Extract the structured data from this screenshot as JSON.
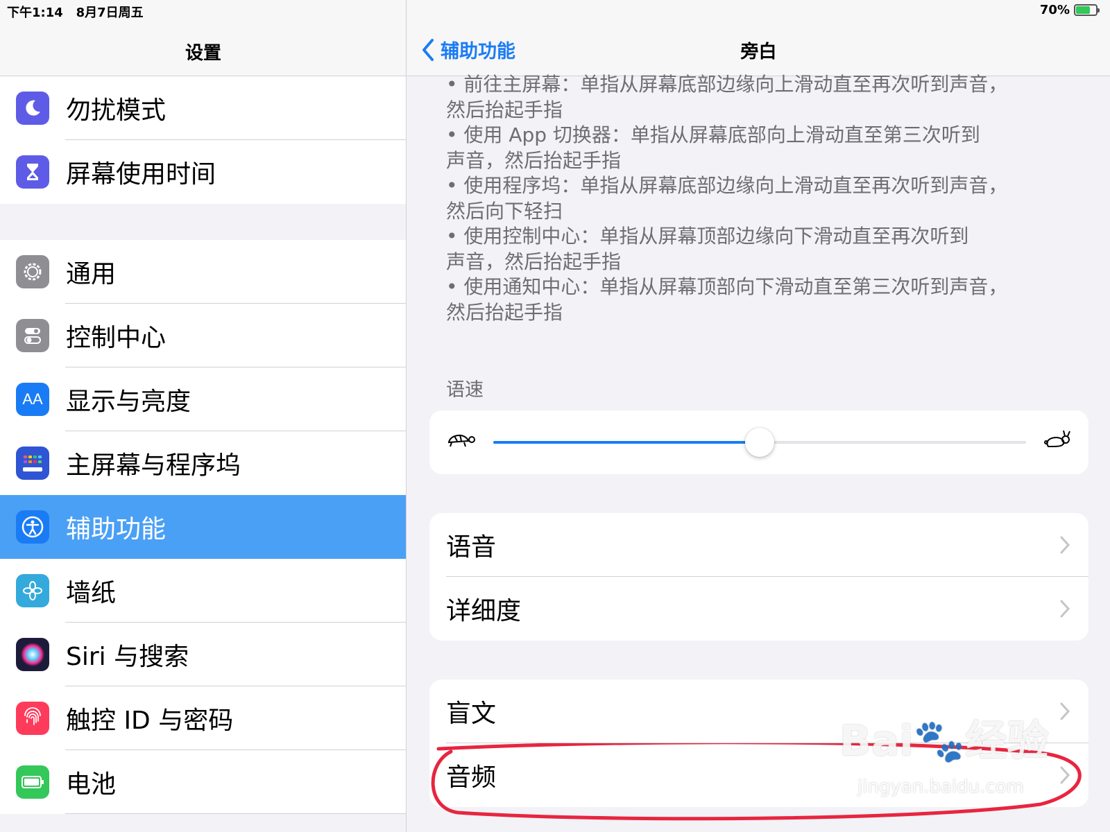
{
  "status": {
    "time": "下午1:14",
    "date": "8月7日周五",
    "battery": "70%",
    "battery_level": 0.7
  },
  "left": {
    "title": "设置",
    "group1": [
      {
        "label": "勿扰模式",
        "icon": "moon-icon",
        "color": "#5e5ce6"
      },
      {
        "label": "屏幕使用时间",
        "icon": "hourglass-icon",
        "color": "#5e5ce6"
      }
    ],
    "group2": [
      {
        "label": "通用",
        "icon": "gear-icon",
        "color": "#8e8e93"
      },
      {
        "label": "控制中心",
        "icon": "toggles-icon",
        "color": "#8e8e93"
      },
      {
        "label": "显示与亮度",
        "icon": "text-size-icon",
        "color": "#1a7cf5"
      },
      {
        "label": "主屏幕与程序坞",
        "icon": "grid-icon",
        "color": "#2f55d4"
      },
      {
        "label": "辅助功能",
        "icon": "accessibility-icon",
        "color": "#1a7cf5",
        "selected": true
      },
      {
        "label": "墙纸",
        "icon": "flower-icon",
        "color": "#34aadc"
      },
      {
        "label": "Siri 与搜索",
        "icon": "siri-icon",
        "color": "#1c1c3a"
      },
      {
        "label": "触控 ID 与密码",
        "icon": "fingerprint-icon",
        "color": "#ff3b5c"
      },
      {
        "label": "电池",
        "icon": "battery-icon",
        "color": "#34c759"
      }
    ],
    "icon_aa": "AA"
  },
  "right": {
    "back_label": "辅助功能",
    "title": "旁白",
    "help_lines": [
      "• 前往主屏幕：单指从屏幕底部边缘向上滑动直至再次听到声音，",
      "然后抬起手指",
      "• 使用 App 切换器：单指从屏幕底部向上滑动直至第三次听到",
      "声音，然后抬起手指",
      "• 使用程序坞：单指从屏幕底部边缘向上滑动直至再次听到声音，",
      "然后向下轻扫",
      "• 使用控制中心：单指从屏幕顶部边缘向下滑动直至再次听到",
      "声音，然后抬起手指",
      "• 使用通知中心：单指从屏幕顶部向下滑动直至第三次听到声音，",
      "然后抬起手指"
    ],
    "speech_rate_label": "语速",
    "speech_rate_value": 0.5,
    "card1": [
      {
        "label": "语音"
      },
      {
        "label": "详细度"
      }
    ],
    "card2": [
      {
        "label": "盲文"
      },
      {
        "label": "音频"
      }
    ]
  },
  "watermark": {
    "brand": "Bai",
    "brand_cn": "经验",
    "url": "jingyan.baidu.com"
  },
  "colors": {
    "accent": "#1a7cf5",
    "selected_row": "#4aa0f5",
    "annotation": "#e8253f"
  }
}
